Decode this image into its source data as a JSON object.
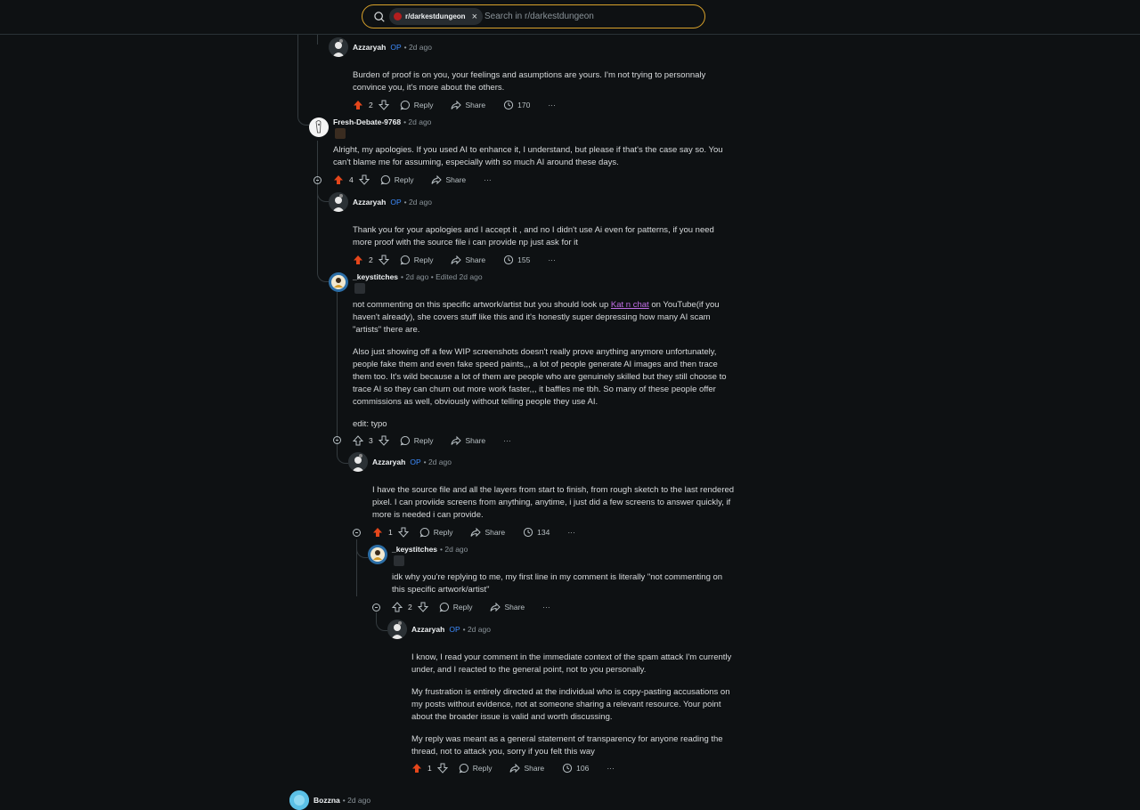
{
  "search": {
    "subreddit_chip": "r/darkestdungeon",
    "placeholder": "Search in r/darkestdungeon"
  },
  "actions": {
    "reply": "Reply",
    "share": "Share",
    "more": "···"
  },
  "comments": [
    {
      "author": "Azzaryah",
      "op": "OP",
      "meta": "• 2d ago",
      "paragraphs": [
        "Burden of proof is on you, your feelings and asumptions are yours. I'm not trying to personnaly convince you, it's more about the others."
      ],
      "votes": "2",
      "upvoted": true,
      "views": "170"
    },
    {
      "author": "Fresh-Debate-9768",
      "op": "",
      "meta": "• 2d ago",
      "paragraphs": [
        "Alright, my apologies. If you used AI to enhance it, I understand, but please if that's the case say so. You can't blame me for assuming, especially with so much AI around these days."
      ],
      "votes": "4",
      "upvoted": true,
      "views": ""
    },
    {
      "author": "Azzaryah",
      "op": "OP",
      "meta": "• 2d ago",
      "paragraphs": [
        "Thank you for your apologies and I accept it , and no I didn't use Ai even for patterns, if you need more proof with the source file i can provide np just ask for it"
      ],
      "votes": "2",
      "upvoted": true,
      "views": "155"
    },
    {
      "author": "_keystitches",
      "op": "",
      "meta": "• 2d ago • Edited 2d ago",
      "p1_before": "not commenting on this specific artwork/artist but you should look up ",
      "p1_link": "Kat n chat",
      "p1_after": " on YouTube(if you haven't already), she covers stuff like this and it's honestly super depressing how many AI scam \"artists\" there are.",
      "paragraphs": [
        "Also just showing off a few WIP screenshots doesn't really prove anything anymore unfortunately, people fake them and even fake speed paints,,, a lot of people generate AI images and then trace them too. It's wild because a lot of them are people who are genuinely skilled but they still choose to trace AI so they can churn out more work faster,,, it baffles me tbh. So many of these people offer commissions as well, obviously without telling people they use AI.",
        "edit: typo"
      ],
      "votes": "3",
      "upvoted": false,
      "views": ""
    },
    {
      "author": "Azzaryah",
      "op": "OP",
      "meta": "• 2d ago",
      "paragraphs": [
        "I have the source file and all the layers from start to finish, from rough sketch to the last rendered pixel. I can proviide screens from anything, anytime, i just did a few screens to answer quickly, if more is needed i can provide."
      ],
      "votes": "1",
      "upvoted": true,
      "views": "134"
    },
    {
      "author": "_keystitches",
      "op": "",
      "meta": "• 2d ago",
      "paragraphs": [
        "idk why you're replying to me, my first line in my comment is literally \"not commenting on this specific artwork/artist\""
      ],
      "votes": "2",
      "upvoted": false,
      "views": ""
    },
    {
      "author": "Azzaryah",
      "op": "OP",
      "meta": "• 2d ago",
      "paragraphs": [
        " I know, I read your comment in the immediate context of the spam attack I'm currently under, and I reacted to the general point, not to you personally.",
        "My frustration is entirely directed at the individual who is copy-pasting accusations on my posts without evidence, not at someone sharing a relevant resource. Your point about the broader issue is valid and worth discussing.",
        "My reply was meant as a general statement of transparency for anyone reading the thread, not to attack you, sorry if you felt this way"
      ],
      "votes": "1",
      "upvoted": true,
      "views": "106"
    },
    {
      "author": "Bozzna",
      "op": "",
      "meta": "• 2d ago",
      "paragraphs": [],
      "votes": "",
      "upvoted": false,
      "views": ""
    }
  ]
}
